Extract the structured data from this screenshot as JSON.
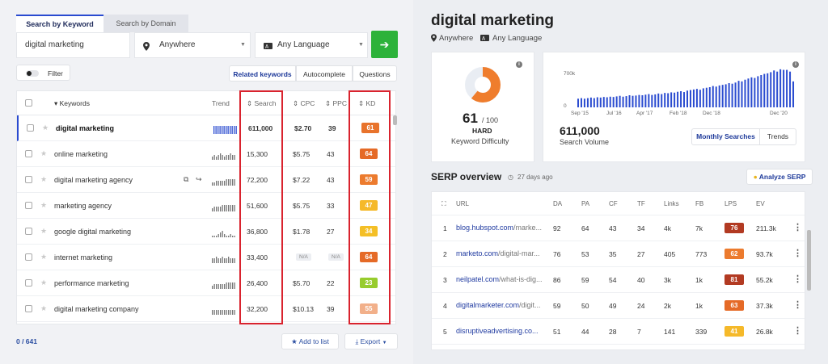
{
  "search": {
    "tab_keyword": "Search by Keyword",
    "tab_domain": "Search by Domain",
    "keyword_value": "digital marketing",
    "location": "Anywhere",
    "language": "Any Language",
    "go_arrow": "➔"
  },
  "toolbar": {
    "filter_label": "Filter",
    "tabs": [
      "Related keywords",
      "Autocomplete",
      "Questions"
    ]
  },
  "table": {
    "headers": {
      "keywords": "Keywords",
      "trend": "Trend",
      "search": "Search",
      "cpc": "CPC",
      "ppc": "PPC",
      "kd": "KD"
    },
    "rows": [
      {
        "keyword": "digital marketing",
        "search": "611,000",
        "cpc": "$2.70",
        "ppc": "39",
        "kd": "61",
        "kd_color": "#e8732c",
        "spark": [
          5,
          5,
          5,
          5,
          5,
          5,
          5,
          5,
          5,
          5,
          5,
          5
        ]
      },
      {
        "keyword": "online marketing",
        "search": "15,300",
        "cpc": "$5.75",
        "ppc": "43",
        "kd": "64",
        "kd_color": "#e56a27",
        "spark": [
          2,
          3,
          2,
          3,
          4,
          3,
          2,
          3,
          3,
          4,
          3,
          3
        ]
      },
      {
        "keyword": "digital marketing agency",
        "search": "72,200",
        "cpc": "$7.22",
        "ppc": "43",
        "kd": "59",
        "kd_color": "#ec7b2e",
        "spark": [
          2,
          2,
          3,
          3,
          3,
          3,
          3,
          4,
          4,
          4,
          4,
          4
        ]
      },
      {
        "keyword": "marketing agency",
        "search": "51,600",
        "cpc": "$5.75",
        "ppc": "33",
        "kd": "47",
        "kd_color": "#f5b92a",
        "spark": [
          2,
          3,
          3,
          3,
          3,
          4,
          4,
          4,
          4,
          4,
          4,
          4
        ]
      },
      {
        "keyword": "google digital marketing",
        "search": "36,800",
        "cpc": "$1.78",
        "ppc": "27",
        "kd": "34",
        "kd_color": "#f4bf26",
        "spark": [
          1,
          1,
          1,
          2,
          3,
          4,
          2,
          1,
          1,
          2,
          1,
          1
        ]
      },
      {
        "keyword": "internet marketing",
        "search": "33,400",
        "cpc": "N/A",
        "ppc": "N/A",
        "kd": "64",
        "kd_color": "#e56a27",
        "spark": [
          3,
          3,
          4,
          3,
          3,
          4,
          3,
          3,
          4,
          3,
          3,
          3
        ]
      },
      {
        "keyword": "performance marketing",
        "search": "26,400",
        "cpc": "$5.70",
        "ppc": "22",
        "kd": "23",
        "kd_color": "#97cc2d",
        "spark": [
          2,
          3,
          3,
          3,
          3,
          3,
          3,
          4,
          4,
          4,
          4,
          4
        ]
      },
      {
        "keyword": "digital marketing company",
        "search": "32,200",
        "cpc": "$10.13",
        "ppc": "39",
        "kd": "55",
        "kd_color": "#f2b08a",
        "spark": [
          3,
          3,
          3,
          3,
          3,
          3,
          3,
          3,
          3,
          3,
          3,
          3
        ]
      }
    ]
  },
  "footer": {
    "count": "0 / 641",
    "add_to_list": "Add to list",
    "export": "Export"
  },
  "detail": {
    "title": "digital marketing",
    "location": "Anywhere",
    "language": "Any Language",
    "kd_value": "61",
    "kd_out_of": "/ 100",
    "kd_level": "HARD",
    "kd_caption": "Keyword Difficulty",
    "kd_fraction": 0.61,
    "volume": "611,000",
    "volume_caption": "Search Volume",
    "toggle_monthly": "Monthly Searches",
    "toggle_trends": "Trends"
  },
  "chart_data": {
    "type": "bar",
    "y_ticks": [
      "700k",
      "0"
    ],
    "x_ticks": [
      "Sep '15",
      "Jul '16",
      "Apr '17",
      "Feb '18",
      "Dec '18",
      "Dec '20"
    ],
    "ylim": [
      0,
      700000
    ],
    "values": [
      150000,
      160000,
      150000,
      160000,
      170000,
      160000,
      175000,
      170000,
      180000,
      175000,
      185000,
      180000,
      190000,
      200000,
      185000,
      195000,
      210000,
      200000,
      205000,
      215000,
      210000,
      220000,
      230000,
      215000,
      225000,
      240000,
      230000,
      250000,
      245000,
      260000,
      255000,
      270000,
      280000,
      265000,
      290000,
      300000,
      310000,
      320000,
      305000,
      330000,
      340000,
      350000,
      370000,
      360000,
      380000,
      390000,
      400000,
      420000,
      410000,
      430000,
      460000,
      450000,
      480000,
      500000,
      520000,
      510000,
      540000,
      560000,
      580000,
      590000,
      610000,
      640000,
      620000,
      660000,
      650000,
      650000,
      620000,
      450000
    ]
  },
  "serp": {
    "title": "SERP overview",
    "age": "27 days ago",
    "analyze_button": "Analyze SERP",
    "headers": {
      "url": "URL",
      "da": "DA",
      "pa": "PA",
      "cf": "CF",
      "tf": "TF",
      "links": "Links",
      "fb": "FB",
      "lps": "LPS",
      "ev": "EV"
    },
    "rows": [
      {
        "rank": "1",
        "domain": "blog.hubspot.com",
        "path": "/marke...",
        "da": "92",
        "pa": "64",
        "cf": "43",
        "tf": "34",
        "links": "4k",
        "fb": "7k",
        "lps": "76",
        "lps_color": "#b23a22",
        "ev": "211.3k"
      },
      {
        "rank": "2",
        "domain": "marketo.com",
        "path": "/digital-mar...",
        "da": "76",
        "pa": "53",
        "cf": "35",
        "tf": "27",
        "links": "405",
        "fb": "773",
        "lps": "62",
        "lps_color": "#ec7b2e",
        "ev": "93.7k"
      },
      {
        "rank": "3",
        "domain": "neilpatel.com",
        "path": "/what-is-dig...",
        "da": "86",
        "pa": "59",
        "cf": "54",
        "tf": "40",
        "links": "3k",
        "fb": "1k",
        "lps": "81",
        "lps_color": "#b23a22",
        "ev": "55.2k"
      },
      {
        "rank": "4",
        "domain": "digitalmarketer.com",
        "path": "/digit...",
        "da": "59",
        "pa": "50",
        "cf": "49",
        "tf": "24",
        "links": "2k",
        "fb": "1k",
        "lps": "63",
        "lps_color": "#e56a27",
        "ev": "37.3k"
      },
      {
        "rank": "5",
        "domain": "disruptiveadvertising.co...",
        "path": "",
        "da": "51",
        "pa": "44",
        "cf": "28",
        "tf": "7",
        "links": "141",
        "fb": "339",
        "lps": "41",
        "lps_color": "#f5b92a",
        "ev": "26.8k"
      }
    ]
  },
  "colors": {
    "accent": "#2a4bd0",
    "go_button": "#2db23a",
    "highlight": "#d9232e",
    "kd_ring": "#ef7d2d"
  },
  "icons": {
    "location": "location-pin-icon",
    "language": "translate-icon",
    "arrow": "arrow-right-icon"
  }
}
